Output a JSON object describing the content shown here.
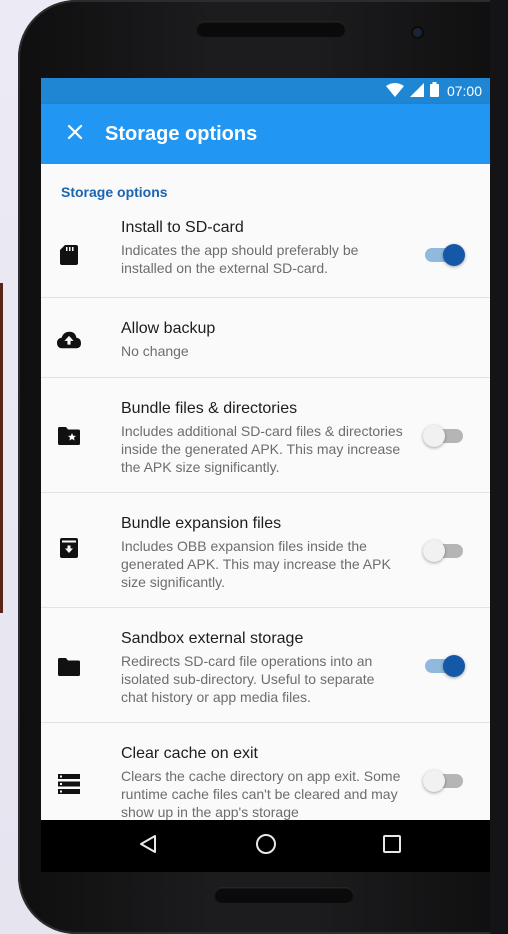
{
  "status_bar": {
    "time": "07:00",
    "icons": [
      "wifi-icon",
      "cell-signal-icon",
      "battery-icon"
    ]
  },
  "app_bar": {
    "title": "Storage options",
    "close_icon": "close-icon"
  },
  "section": {
    "header": "Storage options"
  },
  "preferences": [
    {
      "id": "install-sd-card",
      "icon": "sd-card-icon",
      "title": "Install to SD-card",
      "summary": "Indicates the app should preferably be installed on the external SD-card.",
      "has_switch": true,
      "checked": true
    },
    {
      "id": "allow-backup",
      "icon": "cloud-upload-icon",
      "title": "Allow backup",
      "summary": "No change",
      "has_switch": false
    },
    {
      "id": "bundle-files",
      "icon": "folder-star-icon",
      "title": "Bundle files & directories",
      "summary": "Includes additional SD-card files & directories inside the generated APK. This may increase the APK size significantly.",
      "has_switch": true,
      "checked": false
    },
    {
      "id": "bundle-expansion",
      "icon": "archive-icon",
      "title": "Bundle expansion files",
      "summary": "Includes OBB expansion files inside the generated APK. This may increase the APK size significantly.",
      "has_switch": true,
      "checked": false
    },
    {
      "id": "sandbox-storage",
      "icon": "folder-icon",
      "title": "Sandbox external storage",
      "summary": "Redirects SD-card file operations into an isolated sub-directory. Useful to separate chat history or app media files.",
      "has_switch": true,
      "checked": true
    },
    {
      "id": "clear-cache",
      "icon": "storage-list-icon",
      "title": "Clear cache on exit",
      "summary": "Clears the cache directory on app exit. Some runtime cache files can't be cleared and may show up in the app's storage",
      "has_switch": true,
      "checked": false
    }
  ],
  "nav_bar": {
    "buttons": [
      "back-icon",
      "home-icon",
      "recents-icon"
    ]
  },
  "colors": {
    "status_bar": "#1f86d4",
    "app_bar": "#2196f3",
    "accent": "#1558a8",
    "section_header": "#1a64b0"
  }
}
